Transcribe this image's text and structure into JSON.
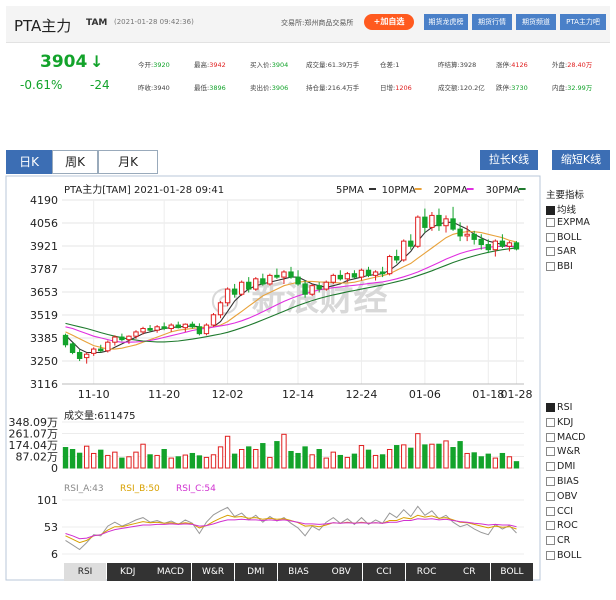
{
  "header": {
    "name": "PTA主力",
    "code": "TAM",
    "datetime": "(2021-01-28 09:42:36)",
    "exchange": "交易所:郑州商品交易所",
    "add_label": "+加自选",
    "links": [
      "期货龙虎榜",
      "期货行情",
      "期货频道",
      "PTA主力吧"
    ]
  },
  "quote": {
    "price": "3904",
    "arrow": "↓",
    "change_pct": "-0.61%",
    "change": "-24",
    "row1": [
      {
        "k": "今开:",
        "v": "3920",
        "c": "g"
      },
      {
        "k": "最高:",
        "v": "3942",
        "c": "v"
      },
      {
        "k": "买入价:",
        "v": "3904",
        "c": "g"
      },
      {
        "k": "成交量:",
        "v": "61.39万手",
        "c": ""
      },
      {
        "k": "仓差:",
        "v": "1",
        "c": ""
      },
      {
        "k": "昨结算:",
        "v": "3928",
        "c": ""
      },
      {
        "k": "涨停:",
        "v": "4126",
        "c": "v"
      },
      {
        "k": "外盘:",
        "v": "28.40万",
        "c": "v"
      }
    ],
    "row2": [
      {
        "k": "昨收:",
        "v": "3940",
        "c": ""
      },
      {
        "k": "最低:",
        "v": "3896",
        "c": "g"
      },
      {
        "k": "卖出价:",
        "v": "3906",
        "c": "g"
      },
      {
        "k": "持仓量:",
        "v": "216.4万手",
        "c": ""
      },
      {
        "k": "日增:",
        "v": "1206",
        "c": "v"
      },
      {
        "k": "成交额:",
        "v": "120.2亿",
        "c": ""
      },
      {
        "k": "跌停:",
        "v": "3730",
        "c": "g"
      },
      {
        "k": "内盘:",
        "v": "32.99万",
        "c": "g"
      }
    ]
  },
  "tabs": [
    "日K",
    "周K",
    "月K"
  ],
  "kbuttons": [
    "拉长K线",
    "缩短K线"
  ],
  "main_chart": {
    "title": "PTA主力[TAM]  2021-01-28  09:41",
    "ma_legend": [
      {
        "label": "5PMA",
        "color": "#333333"
      },
      {
        "label": "10PMA",
        "color": "#e8a23b"
      },
      {
        "label": "20PMA",
        "color": "#e02fe0"
      },
      {
        "label": "30PMA",
        "color": "#1f7a2e"
      }
    ],
    "y_ticks": [
      "4190",
      "4056",
      "3921",
      "3787",
      "3653",
      "3519",
      "3385",
      "3250",
      "3116"
    ],
    "x_ticks": [
      "11-10",
      "11-20",
      "12-02",
      "12-14",
      "12-24",
      "01-06",
      "01-18",
      "01-28"
    ]
  },
  "chart_data": {
    "type": "candlestick",
    "ylim": [
      3116,
      4190
    ],
    "ohlc": [
      [
        3400,
        3410,
        3330,
        3345
      ],
      [
        3350,
        3360,
        3290,
        3300
      ],
      [
        3300,
        3320,
        3250,
        3265
      ],
      [
        3270,
        3300,
        3235,
        3290
      ],
      [
        3295,
        3330,
        3280,
        3320
      ],
      [
        3320,
        3345,
        3300,
        3310
      ],
      [
        3310,
        3370,
        3300,
        3360
      ],
      [
        3360,
        3400,
        3340,
        3390
      ],
      [
        3390,
        3410,
        3365,
        3375
      ],
      [
        3375,
        3400,
        3350,
        3395
      ],
      [
        3395,
        3430,
        3380,
        3420
      ],
      [
        3420,
        3450,
        3405,
        3440
      ],
      [
        3440,
        3460,
        3420,
        3430
      ],
      [
        3430,
        3460,
        3415,
        3450
      ],
      [
        3450,
        3475,
        3430,
        3440
      ],
      [
        3440,
        3470,
        3420,
        3460
      ],
      [
        3460,
        3480,
        3440,
        3445
      ],
      [
        3445,
        3470,
        3420,
        3465
      ],
      [
        3465,
        3480,
        3440,
        3450
      ],
      [
        3450,
        3470,
        3400,
        3410
      ],
      [
        3410,
        3470,
        3400,
        3460
      ],
      [
        3460,
        3530,
        3450,
        3520
      ],
      [
        3520,
        3600,
        3500,
        3590
      ],
      [
        3590,
        3680,
        3570,
        3670
      ],
      [
        3670,
        3700,
        3620,
        3640
      ],
      [
        3640,
        3720,
        3630,
        3710
      ],
      [
        3710,
        3740,
        3650,
        3670
      ],
      [
        3670,
        3740,
        3660,
        3730
      ],
      [
        3730,
        3760,
        3690,
        3700
      ],
      [
        3700,
        3760,
        3690,
        3750
      ],
      [
        3750,
        3790,
        3730,
        3740
      ],
      [
        3740,
        3780,
        3700,
        3770
      ],
      [
        3770,
        3800,
        3730,
        3740
      ],
      [
        3740,
        3780,
        3690,
        3700
      ],
      [
        3700,
        3720,
        3620,
        3640
      ],
      [
        3640,
        3700,
        3630,
        3690
      ],
      [
        3690,
        3710,
        3650,
        3670
      ],
      [
        3670,
        3720,
        3660,
        3710
      ],
      [
        3710,
        3760,
        3700,
        3750
      ],
      [
        3750,
        3780,
        3720,
        3730
      ],
      [
        3730,
        3770,
        3710,
        3760
      ],
      [
        3760,
        3780,
        3730,
        3740
      ],
      [
        3740,
        3790,
        3720,
        3780
      ],
      [
        3780,
        3800,
        3740,
        3750
      ],
      [
        3750,
        3780,
        3720,
        3770
      ],
      [
        3770,
        3800,
        3740,
        3760
      ],
      [
        3760,
        3870,
        3750,
        3860
      ],
      [
        3860,
        3900,
        3820,
        3840
      ],
      [
        3840,
        3960,
        3830,
        3950
      ],
      [
        3950,
        3990,
        3900,
        3920
      ],
      [
        3920,
        4100,
        3910,
        4090
      ],
      [
        4090,
        4140,
        4000,
        4030
      ],
      [
        4030,
        4120,
        4010,
        4100
      ],
      [
        4100,
        4140,
        4010,
        4040
      ],
      [
        4040,
        4100,
        4000,
        4080
      ],
      [
        4080,
        4150,
        4010,
        4020
      ],
      [
        4020,
        4060,
        3950,
        3980
      ],
      [
        3980,
        4040,
        3950,
        3990
      ],
      [
        3990,
        4010,
        3930,
        3960
      ],
      [
        3960,
        3990,
        3900,
        3930
      ],
      [
        3930,
        3960,
        3880,
        3900
      ],
      [
        3900,
        3960,
        3860,
        3950
      ],
      [
        3950,
        3990,
        3910,
        3920
      ],
      [
        3920,
        3950,
        3890,
        3940
      ],
      [
        3940,
        3950,
        3896,
        3904
      ]
    ],
    "ma": {
      "5": [
        3400,
        3360,
        3320,
        3300,
        3300,
        3300,
        3310,
        3330,
        3350,
        3370,
        3390,
        3410,
        3420,
        3430,
        3440,
        3445,
        3450,
        3452,
        3455,
        3450,
        3440,
        3450,
        3480,
        3540,
        3600,
        3640,
        3670,
        3690,
        3700,
        3710,
        3720,
        3730,
        3740,
        3740,
        3720,
        3700,
        3690,
        3680,
        3690,
        3700,
        3720,
        3730,
        3740,
        3750,
        3755,
        3760,
        3780,
        3810,
        3850,
        3890,
        3950,
        4000,
        4030,
        4050,
        4060,
        4060,
        4040,
        4020,
        3990,
        3970,
        3950,
        3940,
        3930,
        3920,
        3915
      ],
      "10": [
        3420,
        3400,
        3380,
        3360,
        3340,
        3330,
        3320,
        3320,
        3325,
        3335,
        3345,
        3360,
        3375,
        3390,
        3405,
        3420,
        3430,
        3435,
        3440,
        3445,
        3448,
        3450,
        3460,
        3480,
        3510,
        3540,
        3570,
        3600,
        3630,
        3650,
        3670,
        3690,
        3700,
        3710,
        3715,
        3715,
        3712,
        3710,
        3708,
        3706,
        3705,
        3710,
        3720,
        3730,
        3740,
        3748,
        3760,
        3780,
        3800,
        3820,
        3850,
        3880,
        3910,
        3940,
        3970,
        3990,
        4000,
        4005,
        4005,
        4000,
        3990,
        3980,
        3970,
        3955,
        3945
      ],
      "20": [
        3450,
        3440,
        3425,
        3410,
        3395,
        3385,
        3375,
        3365,
        3360,
        3360,
        3362,
        3365,
        3370,
        3378,
        3388,
        3398,
        3408,
        3418,
        3428,
        3436,
        3442,
        3448,
        3455,
        3462,
        3472,
        3485,
        3500,
        3518,
        3538,
        3558,
        3578,
        3598,
        3615,
        3630,
        3643,
        3655,
        3665,
        3672,
        3678,
        3683,
        3688,
        3692,
        3697,
        3702,
        3707,
        3712,
        3720,
        3730,
        3742,
        3755,
        3770,
        3788,
        3806,
        3825,
        3845,
        3862,
        3878,
        3890,
        3900,
        3908,
        3914,
        3918,
        3920,
        3920,
        3920
      ],
      "30": [
        3470,
        3460,
        3450,
        3440,
        3428,
        3416,
        3405,
        3395,
        3386,
        3378,
        3372,
        3367,
        3364,
        3362,
        3362,
        3364,
        3367,
        3372,
        3378,
        3385,
        3392,
        3400,
        3408,
        3418,
        3430,
        3444,
        3458,
        3474,
        3490,
        3507,
        3524,
        3541,
        3558,
        3574,
        3589,
        3603,
        3615,
        3626,
        3636,
        3645,
        3654,
        3662,
        3670,
        3678,
        3686,
        3694,
        3703,
        3713,
        3723,
        3735,
        3748,
        3762,
        3777,
        3793,
        3809,
        3825,
        3839,
        3852,
        3864,
        3875,
        3885,
        3893,
        3900,
        3905,
        3910
      ]
    },
    "volume_label": "成交量:611475",
    "volume_ticks": [
      "348.09万",
      "261.07万",
      "174.04万",
      "87.02万",
      "0"
    ],
    "volume_max": 348.09,
    "volume": [
      155,
      140,
      112,
      165,
      110,
      135,
      95,
      120,
      75,
      85,
      120,
      180,
      100,
      95,
      140,
      75,
      85,
      98,
      110,
      92,
      80,
      100,
      160,
      240,
      105,
      140,
      160,
      140,
      185,
      80,
      200,
      255,
      125,
      110,
      160,
      100,
      140,
      75,
      120,
      95,
      80,
      105,
      170,
      135,
      95,
      100,
      140,
      170,
      175,
      150,
      260,
      175,
      180,
      180,
      205,
      155,
      200,
      110,
      115,
      85,
      105,
      75,
      110,
      85,
      48
    ],
    "rsi_label": {
      "a": "RSI_A:43",
      "b": "RSI_B:50",
      "c": "RSI_C:54"
    },
    "rsi_ticks": [
      "101",
      "53",
      "6"
    ],
    "rsi_a": [
      30,
      22,
      14,
      26,
      40,
      38,
      55,
      62,
      55,
      60,
      66,
      70,
      62,
      65,
      60,
      64,
      58,
      66,
      60,
      42,
      62,
      75,
      82,
      88,
      72,
      78,
      66,
      74,
      62,
      72,
      64,
      70,
      60,
      52,
      38,
      55,
      48,
      62,
      70,
      60,
      68,
      58,
      70,
      58,
      66,
      60,
      78,
      70,
      84,
      72,
      90,
      74,
      82,
      68,
      74,
      62,
      54,
      58,
      50,
      44,
      40,
      58,
      50,
      56,
      43
    ],
    "rsi_b": [
      38,
      32,
      26,
      30,
      38,
      40,
      48,
      54,
      54,
      57,
      60,
      63,
      61,
      62,
      60,
      61,
      59,
      61,
      59,
      52,
      56,
      63,
      69,
      74,
      71,
      72,
      69,
      70,
      67,
      69,
      67,
      68,
      65,
      61,
      55,
      56,
      54,
      57,
      61,
      60,
      62,
      60,
      62,
      60,
      61,
      60,
      65,
      65,
      70,
      68,
      74,
      71,
      73,
      69,
      70,
      66,
      62,
      61,
      58,
      55,
      52,
      55,
      53,
      54,
      50
    ],
    "rsi_c": [
      42,
      38,
      33,
      34,
      38,
      40,
      45,
      49,
      51,
      53,
      55,
      57,
      57,
      58,
      58,
      59,
      58,
      59,
      58,
      55,
      56,
      59,
      63,
      66,
      66,
      67,
      66,
      66,
      65,
      66,
      65,
      66,
      64,
      62,
      59,
      59,
      58,
      59,
      61,
      60,
      61,
      60,
      61,
      60,
      61,
      60,
      62,
      62,
      65,
      65,
      68,
      67,
      68,
      66,
      67,
      65,
      63,
      62,
      60,
      59,
      57,
      58,
      57,
      57,
      54
    ]
  },
  "sidebar": {
    "heading": "主要指标",
    "main_indicators": [
      {
        "label": "均线",
        "on": true
      },
      {
        "label": "EXPMA",
        "on": false
      },
      {
        "label": "BOLL",
        "on": false
      },
      {
        "label": "SAR",
        "on": false
      },
      {
        "label": "BBI",
        "on": false
      }
    ],
    "sub_indicators": [
      {
        "label": "RSI",
        "on": true
      },
      {
        "label": "KDJ",
        "on": false
      },
      {
        "label": "MACD",
        "on": false
      },
      {
        "label": "W&R",
        "on": false
      },
      {
        "label": "DMI",
        "on": false
      },
      {
        "label": "BIAS",
        "on": false
      },
      {
        "label": "OBV",
        "on": false
      },
      {
        "label": "CCI",
        "on": false
      },
      {
        "label": "ROC",
        "on": false
      },
      {
        "label": "CR",
        "on": false
      },
      {
        "label": "BOLL",
        "on": false
      }
    ]
  },
  "bottom_tabs": [
    "RSI",
    "KDJ",
    "MACD",
    "W&R",
    "DMI",
    "BIAS",
    "OBV",
    "CCI",
    "ROC",
    "CR",
    "BOLL"
  ],
  "colors": {
    "up": "#e02020",
    "down": "#13a32b",
    "accent": "#3c6eb4"
  }
}
